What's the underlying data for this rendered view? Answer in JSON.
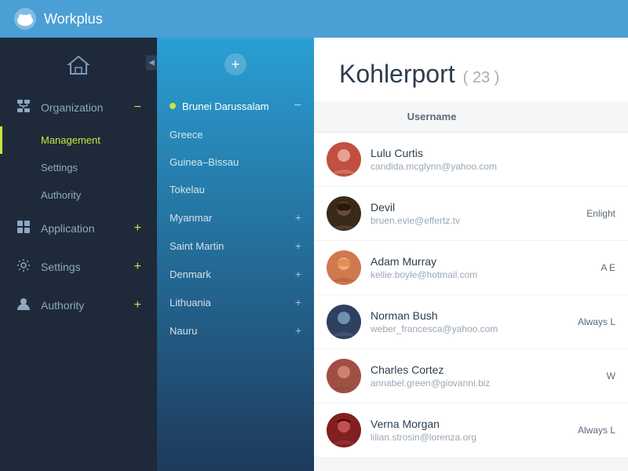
{
  "header": {
    "app_name": "Workplus"
  },
  "sidebar": {
    "items": [
      {
        "id": "organization",
        "label": "Organization",
        "icon": "org",
        "action": "minus"
      },
      {
        "id": "management",
        "label": "Management",
        "sub": true,
        "active": true
      },
      {
        "id": "settings_sub",
        "label": "Settings",
        "sub": true
      },
      {
        "id": "authority_sub",
        "label": "Authority",
        "sub": true
      },
      {
        "id": "application",
        "label": "Application",
        "icon": "app",
        "action": "plus"
      },
      {
        "id": "settings",
        "label": "Settings",
        "icon": "settings",
        "action": "plus"
      },
      {
        "id": "authority",
        "label": "Authority",
        "icon": "authority",
        "action": "plus"
      }
    ]
  },
  "middle_panel": {
    "add_button_label": "+",
    "countries": [
      {
        "id": "brunei",
        "name": "Brunei Darussalam",
        "active": true,
        "action": "minus"
      },
      {
        "id": "greece",
        "name": "Greece",
        "action": null
      },
      {
        "id": "guinea",
        "name": "Guinea–Bissau",
        "action": null
      },
      {
        "id": "tokelau",
        "name": "Tokelau",
        "action": null
      },
      {
        "id": "myanmar",
        "name": "Myanmar",
        "action": "plus"
      },
      {
        "id": "saint_martin",
        "name": "Saint Martin",
        "action": "plus"
      },
      {
        "id": "denmark",
        "name": "Denmark",
        "action": "plus"
      },
      {
        "id": "lithuania",
        "name": "Lithuania",
        "action": "plus"
      },
      {
        "id": "nauru",
        "name": "Nauru",
        "action": "plus"
      }
    ]
  },
  "content": {
    "title": "Kohlerport",
    "count": "( 23 )",
    "table": {
      "columns": [
        "Username",
        ""
      ],
      "rows": [
        {
          "id": 1,
          "name": "Lulu Curtis",
          "email": "candida.mcglynn@yahoo.com",
          "role": "",
          "avatar_class": "av1",
          "avatar_text": "👩"
        },
        {
          "id": 2,
          "name": "Devil",
          "email": "bruen.evie@effertz.tv",
          "role": "Enlight",
          "avatar_class": "av2",
          "avatar_text": "👩"
        },
        {
          "id": 3,
          "name": "Adam Murray",
          "email": "kellie.boyle@hotmail.com",
          "role": "A E",
          "avatar_class": "av3",
          "avatar_text": "👩"
        },
        {
          "id": 4,
          "name": "Norman Bush",
          "email": "weber_francesca@yahoo.com",
          "role": "Always L",
          "avatar_class": "av4",
          "avatar_text": "👨"
        },
        {
          "id": 5,
          "name": "Charles Cortez",
          "email": "annabel.green@giovanni.biz",
          "role": "W",
          "avatar_class": "av5",
          "avatar_text": "👨"
        },
        {
          "id": 6,
          "name": "Verna Morgan",
          "email": "lilian.strosin@lorenza.org",
          "role": "Always L",
          "avatar_class": "av6",
          "avatar_text": "👩"
        }
      ]
    }
  },
  "icons": {
    "home": "⌂",
    "org": "⊞",
    "app": "▦",
    "settings": "⚙",
    "authority": "👤",
    "plus": "+",
    "minus": "−",
    "chevron_left": "◀"
  },
  "colors": {
    "accent": "#c8e63c",
    "header_bg": "#4a9fd4",
    "sidebar_bg": "#1e2a3a",
    "middle_bg_top": "#2a9fd4",
    "middle_bg_bottom": "#1e3a5c"
  }
}
